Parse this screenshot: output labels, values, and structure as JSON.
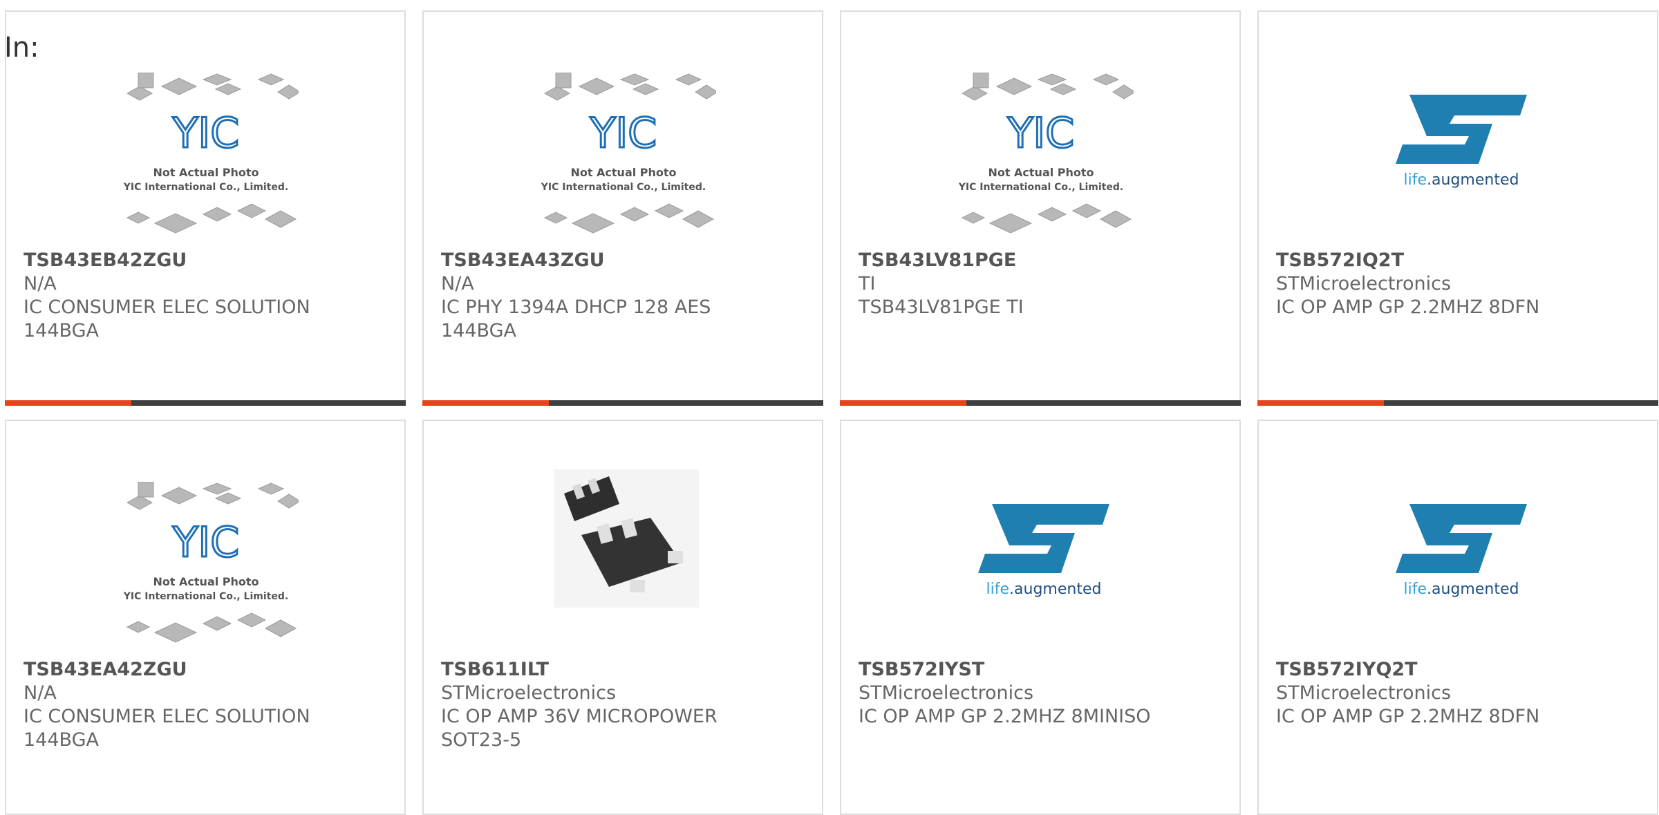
{
  "header": {
    "in_label": "In:"
  },
  "image_text": {
    "yic_caption_1": "Not Actual Photo",
    "yic_caption_2": "YIC International Co., Limited.",
    "yic_logo": "YIC",
    "st_tagline_1": "life",
    "st_tagline_2": ".augmented"
  },
  "products": [
    {
      "part": "TSB43EB42ZGU",
      "maker": "N/A",
      "desc1": "IC CONSUMER ELEC SOLUTION",
      "desc2": "144BGA",
      "image": "yic-placeholder"
    },
    {
      "part": "TSB43EA43ZGU",
      "maker": "N/A",
      "desc1": "IC PHY 1394A DHCP 128 AES",
      "desc2": "144BGA",
      "image": "yic-placeholder"
    },
    {
      "part": "TSB43LV81PGE",
      "maker": "TI",
      "desc1": "TSB43LV81PGE TI",
      "desc2": "",
      "image": "yic-placeholder"
    },
    {
      "part": "TSB572IQ2T",
      "maker": "STMicroelectronics",
      "desc1": "IC OP AMP GP 2.2MHZ 8DFN",
      "desc2": "",
      "image": "st-logo"
    },
    {
      "part": "TSB43EA42ZGU",
      "maker": "N/A",
      "desc1": "IC CONSUMER ELEC SOLUTION",
      "desc2": "144BGA",
      "image": "yic-placeholder"
    },
    {
      "part": "TSB611ILT",
      "maker": "STMicroelectronics",
      "desc1": "IC OP AMP 36V MICROPOWER",
      "desc2": "SOT23-5",
      "image": "sot23-chip"
    },
    {
      "part": "TSB572IYST",
      "maker": "STMicroelectronics",
      "desc1": "IC OP AMP GP 2.2MHZ 8MINISO",
      "desc2": "",
      "image": "st-logo"
    },
    {
      "part": "TSB572IYQ2T",
      "maker": "STMicroelectronics",
      "desc1": "IC OP AMP GP 2.2MHZ 8DFN",
      "desc2": "",
      "image": "st-logo"
    }
  ],
  "colors": {
    "accent": "#e8441c",
    "bar": "#3f3f3f",
    "st_blue": "#1f7fb0",
    "yic_blue": "#1f6fb5"
  }
}
